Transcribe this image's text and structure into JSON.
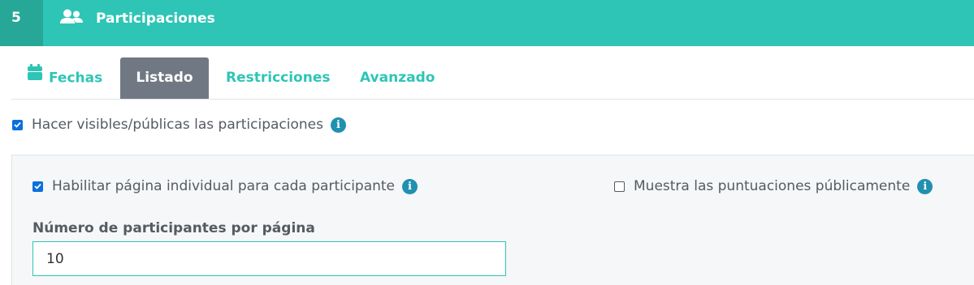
{
  "header": {
    "step_number": "5",
    "title": "Participaciones",
    "icon": "users-icon"
  },
  "tabs": [
    {
      "label": "Fechas",
      "icon": "calendar-icon",
      "active": false
    },
    {
      "label": "Listado",
      "active": true
    },
    {
      "label": "Restricciones",
      "active": false
    },
    {
      "label": "Avanzado",
      "active": false
    }
  ],
  "options": {
    "visible_public": {
      "label": "Hacer visibles/públicas las participaciones",
      "checked": true
    },
    "individual_page": {
      "label": "Habilitar página individual para cada participante",
      "checked": true
    },
    "show_scores": {
      "label": "Muestra las puntuaciones públicamente",
      "checked": false
    }
  },
  "per_page": {
    "label": "Número de participantes por página",
    "value": "10"
  },
  "colors": {
    "accent": "#2ec5b6",
    "accent_dark": "#27a797",
    "active_tab": "#707883",
    "info": "#2090b0",
    "checkbox": "#0b6fde"
  }
}
